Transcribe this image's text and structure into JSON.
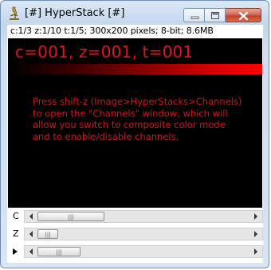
{
  "window": {
    "title": "[#] HyperStack [#]",
    "buttons": {
      "minimize": "minimize",
      "maximize": "maximize",
      "close": "close"
    }
  },
  "info_line": "c:1/3 z:1/10 t:1/5; 300x200 pixels; 8-bit; 8.6MB",
  "canvas": {
    "overlay_label": "c=001, z=001, t=001",
    "message_lines": [
      "Press shift-z (Image>HyperStacks>Channels)",
      "to open the \"Channels\" window, which will",
      "allow you switch to composite color mode",
      "and to enable/disable channels."
    ],
    "text_color": "#d2141b",
    "background": "#000000"
  },
  "sliders": [
    {
      "label": "C",
      "value": 1,
      "max": 3
    },
    {
      "label": "Z",
      "value": 1,
      "max": 10
    },
    {
      "label": "▶",
      "value": 1,
      "max": 5
    }
  ],
  "colors": {
    "title_bar": "#c4d6ec",
    "close_button": "#c24227",
    "accent_red": "#e8111b"
  }
}
